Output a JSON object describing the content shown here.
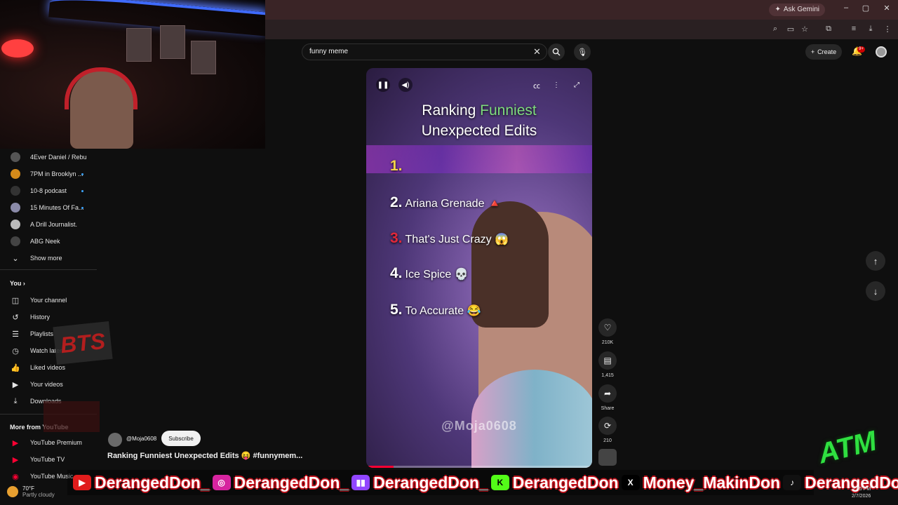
{
  "browser": {
    "gemini_label": "Ask Gemini",
    "minimize": "–",
    "maximize": "▢",
    "close": "✕"
  },
  "search": {
    "query": "funny meme",
    "clear": "✕",
    "mic": "🎙"
  },
  "header": {
    "create_label": "Create",
    "notif_badge": "9+"
  },
  "sidebar": {
    "subscriptions": [
      {
        "label": "4Ever Daniel / Rebu...",
        "live": false
      },
      {
        "label": "7PM in Brooklyn ...",
        "live": true
      },
      {
        "label": "10-8 podcast",
        "live": true
      },
      {
        "label": "15 Minutes Of Fa...",
        "live": true
      },
      {
        "label": "A Drill Journalist.",
        "live": false
      },
      {
        "label": "ABG Neek",
        "live": false
      }
    ],
    "show_more": "Show more",
    "you_title": "You",
    "you_items": [
      "Your channel",
      "History",
      "Playlists",
      "Watch later",
      "Liked videos",
      "Your videos",
      "Downloads"
    ],
    "more_title": "More from YouTube",
    "more_items": [
      "YouTube Premium",
      "YouTube TV",
      "YouTube Music"
    ]
  },
  "video": {
    "title_line1_a": "Ranking ",
    "title_line1_b": "Funniest",
    "title_line2": "Unexpected Edits",
    "ranks": [
      {
        "num": "1.",
        "text": ""
      },
      {
        "num": "2.",
        "text": "Ariana Grenade"
      },
      {
        "num": "3.",
        "text": "That's Just Crazy"
      },
      {
        "num": "4.",
        "text": "Ice Spice"
      },
      {
        "num": "5.",
        "text": "To Accurate"
      }
    ],
    "watermark": "@Moja0608",
    "progress": 0.12
  },
  "actions": {
    "likes": "210K",
    "comments": "1,415",
    "share": "Share",
    "remix": "210"
  },
  "channel": {
    "handle": "@Moja0608",
    "subscribe": "Subscribe",
    "video_title": "Ranking Funniest Unexpected Edits 😝 #funnymem..."
  },
  "overlay": {
    "bts": "BTS",
    "atm": "ATM",
    "socials": [
      {
        "icon": "youtube-icon",
        "glyph": "▶",
        "handle": "DerangedDon_"
      },
      {
        "icon": "instagram-icon",
        "glyph": "◎",
        "handle": "DerangedDon_"
      },
      {
        "icon": "twitch-icon",
        "glyph": "▮▮",
        "handle": "DerangedDon_"
      },
      {
        "icon": "kick-icon",
        "glyph": "K",
        "handle": "DerangedDon"
      },
      {
        "icon": "x-icon",
        "glyph": "X",
        "handle": "Money_MakinDon"
      },
      {
        "icon": "tiktok-icon",
        "glyph": "♪",
        "handle": "DerangedDon_"
      }
    ]
  },
  "taskbar": {
    "temp": "70°F",
    "weather": "Partly cloudy",
    "time": "2:45 PM",
    "date": "2/7/2026"
  },
  "colors": {
    "accent_red": "#ff0033",
    "title_green": "#7fdc7f",
    "rank_gold": "#f4d34a"
  }
}
